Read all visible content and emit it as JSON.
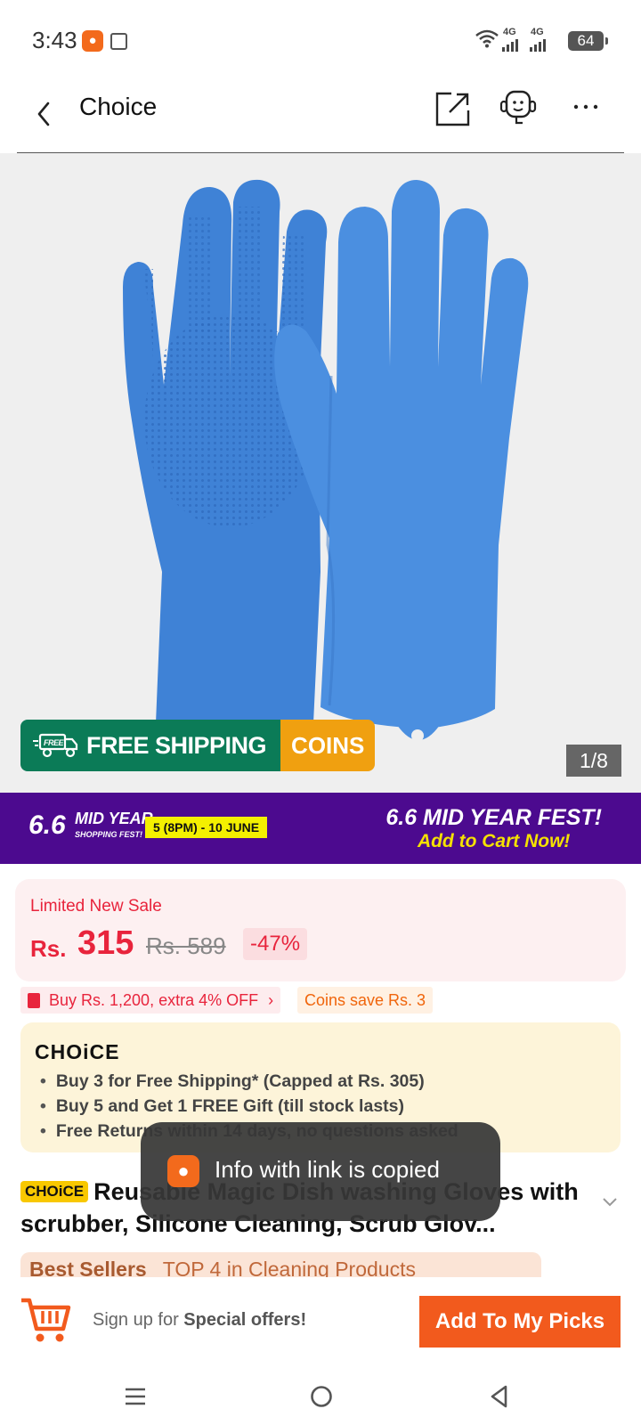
{
  "status_bar": {
    "time": "3:43",
    "network1": "4G",
    "network2": "4G",
    "battery": "64"
  },
  "header": {
    "title": "Choice"
  },
  "gallery": {
    "shipping_badge": "FREE SHIPPING",
    "coins_badge": "COINS",
    "truck_label": "FREE",
    "counter": "1/8",
    "product_color": "#3f82d6"
  },
  "fest_banner": {
    "number": "6.6",
    "mid_year": "MID YEAR",
    "shopping_fest": "SHOPPING FEST!",
    "date": "5 (8PM) - 10 JUNE",
    "headline": "6.6 MID YEAR FEST!",
    "cta": "Add to Cart Now!"
  },
  "price": {
    "label": "Limited New Sale",
    "currency": "Rs.",
    "value": "315",
    "original": "Rs. 589",
    "discount": "-47%"
  },
  "promos": {
    "extra_off": "Buy Rs. 1,200, extra 4% OFF",
    "coins_save": "Coins save Rs. 3"
  },
  "choice_box": {
    "logo": "CHOiCE",
    "bullets": [
      "Buy 3 for  Free Shipping* (Capped at Rs. 305)",
      "Buy 5 and Get 1 FREE Gift (till stock lasts)",
      "Free Returns within 14 days, no questions asked"
    ]
  },
  "product": {
    "badge": "CHOiCE",
    "title": "Reusable Magic Dish washing Gloves with scrubber, Silicone Cleaning, Scrub Glov..."
  },
  "best_sellers": {
    "label": "Best Sellers",
    "rank": "TOP 4 in Cleaning Products"
  },
  "toast": {
    "message": "Info with link is copied"
  },
  "bottom_bar": {
    "signup_prefix": "Sign up for",
    "signup_bold": "Special offers!",
    "add_button": "Add To My Picks"
  },
  "colors": {
    "accent": "#f25a1d",
    "sale_red": "#e8243c",
    "fest_purple": "#4c0a8f",
    "ship_green": "#0b7b57",
    "coins_orange": "#f0a010"
  }
}
